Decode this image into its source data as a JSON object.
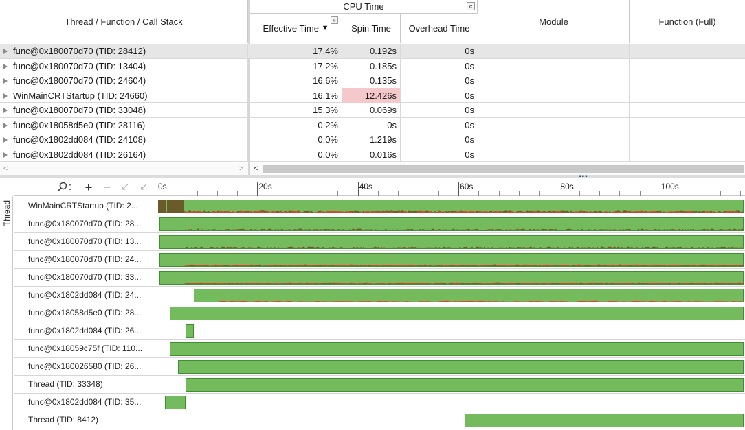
{
  "grid": {
    "col_name": "Thread / Function / Call Stack",
    "group_cpu": "CPU Time",
    "group_collapse": "«",
    "col_effective": "Effective Time",
    "sort_arrow": "▼",
    "expand_glyph": "»",
    "col_spin": "Spin Time",
    "col_overhead": "Overhead Time",
    "col_module": "Module",
    "col_full": "Function (Full)",
    "rows": [
      {
        "name": "func@0x180070d70 (TID: 28412)",
        "effective": "17.4%",
        "spin": "0.192s",
        "overhead": "0s",
        "selected": true,
        "hot": false
      },
      {
        "name": "func@0x180070d70 (TID: 13404)",
        "effective": "17.2%",
        "spin": "0.185s",
        "overhead": "0s",
        "selected": false,
        "hot": false
      },
      {
        "name": "func@0x180070d70 (TID: 24604)",
        "effective": "16.6%",
        "spin": "0.135s",
        "overhead": "0s",
        "selected": false,
        "hot": false
      },
      {
        "name": "WinMainCRTStartup (TID: 24660)",
        "effective": "16.1%",
        "spin": "12.426s",
        "overhead": "0s",
        "selected": false,
        "hot": true
      },
      {
        "name": "func@0x180070d70 (TID: 33048)",
        "effective": "15.3%",
        "spin": "0.069s",
        "overhead": "0s",
        "selected": false,
        "hot": false
      },
      {
        "name": "func@0x18058d5e0 (TID: 28116)",
        "effective": "0.2%",
        "spin": "0s",
        "overhead": "0s",
        "selected": false,
        "hot": false
      },
      {
        "name": "func@0x1802dd084 (TID: 24108)",
        "effective": "0.0%",
        "spin": "1.219s",
        "overhead": "0s",
        "selected": false,
        "hot": false
      },
      {
        "name": "func@0x1802dd084 (TID: 26164)",
        "effective": "0.0%",
        "spin": "0.016s",
        "overhead": "0s",
        "selected": false,
        "hot": false
      }
    ]
  },
  "timeline": {
    "vtab_label": "Thread",
    "toolbar": {
      "search_icon": "search-icon",
      "colon": ":",
      "zoom_in": "+",
      "zoom_out": "−",
      "undo": "↙",
      "reset": "↙"
    },
    "ruler": {
      "max_seconds": 116.7,
      "labels": [
        0,
        20,
        40,
        60,
        80,
        100
      ],
      "unit": "s"
    },
    "colors": {
      "running": "#74bb5e",
      "spin": "#d9472b",
      "wait": "#6b5a2a"
    },
    "threads": [
      {
        "label": "WinMainCRTStartup (TID: 2...",
        "start_s": 0.3,
        "end_s": 116.7,
        "noise": "heavy"
      },
      {
        "label": "func@0x180070d70 (TID: 28...",
        "start_s": 0.6,
        "end_s": 116.7,
        "noise": "light"
      },
      {
        "label": "func@0x180070d70 (TID: 13...",
        "start_s": 0.6,
        "end_s": 116.7,
        "noise": "light"
      },
      {
        "label": "func@0x180070d70 (TID: 24...",
        "start_s": 0.6,
        "end_s": 116.7,
        "noise": "light"
      },
      {
        "label": "func@0x180070d70 (TID: 33...",
        "start_s": 0.6,
        "end_s": 116.7,
        "noise": "light"
      },
      {
        "label": "func@0x1802dd084 (TID: 24...",
        "start_s": 7.4,
        "end_s": 116.7,
        "noise": "sparse"
      },
      {
        "label": "func@0x18058d5e0 (TID: 28...",
        "start_s": 2.6,
        "end_s": 116.7,
        "noise": "none"
      },
      {
        "label": "func@0x1802dd084 (TID: 26...",
        "start_s": 5.7,
        "end_s": 7.4,
        "noise": "none"
      },
      {
        "label": "func@0x18059c75f (TID: 110...",
        "start_s": 2.6,
        "end_s": 116.7,
        "noise": "none"
      },
      {
        "label": "func@0x180026580 (TID: 26...",
        "start_s": 4.2,
        "end_s": 116.7,
        "noise": "none"
      },
      {
        "label": "Thread (TID: 33348)",
        "start_s": 5.8,
        "end_s": 116.7,
        "noise": "none"
      },
      {
        "label": "func@0x1802dd084 (TID: 35...",
        "start_s": 1.6,
        "end_s": 5.7,
        "noise": "none"
      },
      {
        "label": "Thread (TID: 8412)",
        "start_s": 61.2,
        "end_s": 116.7,
        "noise": "none"
      }
    ]
  }
}
